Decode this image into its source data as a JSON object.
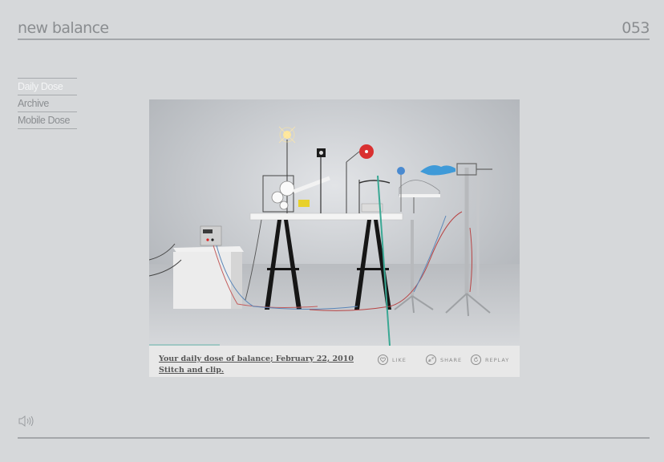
{
  "header": {
    "brand": "new balance",
    "issue_number": "053"
  },
  "nav": {
    "items": [
      {
        "label": "Daily Dose",
        "active": true
      },
      {
        "label": "Archive",
        "active": false
      },
      {
        "label": "Mobile Dose",
        "active": false
      }
    ]
  },
  "player": {
    "progress": 0.19,
    "caption": {
      "line1": "Your daily dose of balance; February 22, 2010",
      "line2": "Stitch and clip."
    },
    "actions": {
      "like": "LIKE",
      "share": "SHARE",
      "replay": "REPLAY"
    }
  },
  "footer": {
    "sound_icon": "speaker-icon"
  },
  "colors": {
    "background": "#d6d8da",
    "text_gray": "#8a8d90",
    "active_nav": "#f4f5f6",
    "caption_bar": "#e8e8e8",
    "progress": "#9fc7c3",
    "wheel_red": "#d93030",
    "blue_hand": "#3f9ad8"
  }
}
